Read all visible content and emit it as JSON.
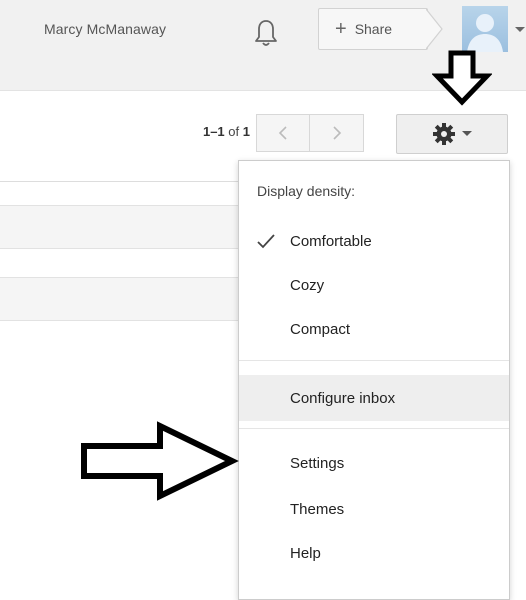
{
  "header": {
    "user_name": "Marcy McManaway",
    "share_label": "Share"
  },
  "toolbar": {
    "page_range": "1–1",
    "page_of": "of",
    "page_total": "1"
  },
  "settings_menu": {
    "heading": "Display density:",
    "density_options": [
      {
        "label": "Comfortable",
        "selected": true
      },
      {
        "label": "Cozy",
        "selected": false
      },
      {
        "label": "Compact",
        "selected": false
      }
    ],
    "configure_inbox": "Configure inbox",
    "items": [
      "Settings",
      "Themes",
      "Help"
    ]
  },
  "colors": {
    "header_bg": "#f1f1f1",
    "menu_hover": "#eeeeee",
    "annotation_arrow": "#000000"
  }
}
